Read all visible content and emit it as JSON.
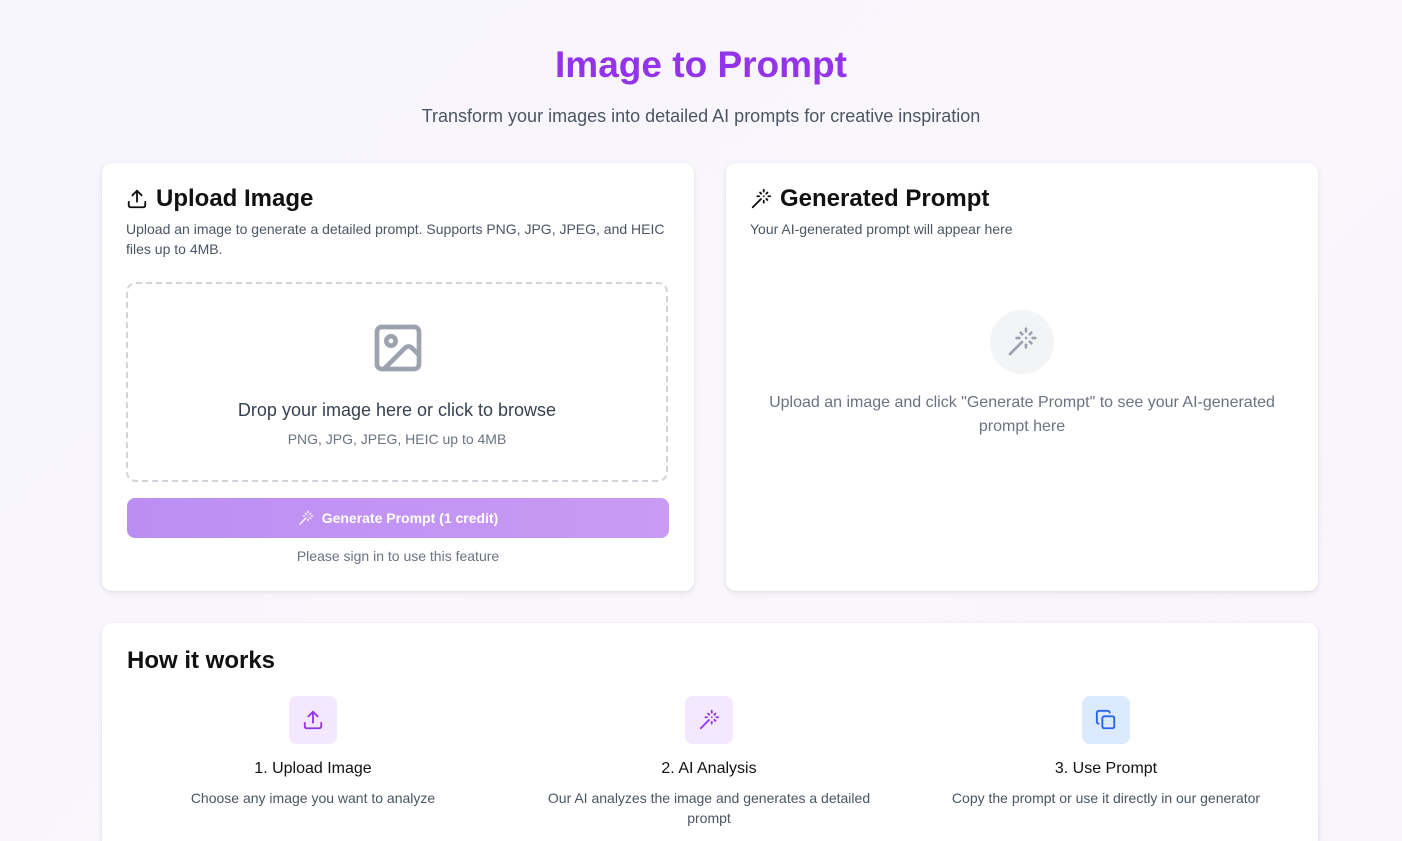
{
  "hero": {
    "title": "Image to Prompt",
    "subtitle": "Transform your images into detailed AI prompts for creative inspiration"
  },
  "upload_card": {
    "icon": "upload-icon",
    "title": "Upload Image",
    "description": "Upload an image to generate a detailed prompt. Supports PNG, JPG, JPEG, and HEIC files up to 4MB.",
    "dropzone": {
      "icon": "image-icon",
      "main_text": "Drop your image here or click to browse",
      "sub_text": "PNG, JPG, JPEG, HEIC up to 4MB"
    },
    "generate_button": {
      "icon": "magic-wand-icon",
      "label": "Generate Prompt (1 credit)"
    },
    "signin_note": "Please sign in to use this feature"
  },
  "prompt_card": {
    "icon": "magic-wand-icon",
    "title": "Generated Prompt",
    "description": "Your AI-generated prompt will appear here",
    "empty_icon": "magic-wand-icon",
    "empty_text": "Upload an image and click \"Generate Prompt\" to see your AI-generated prompt here"
  },
  "how_it_works": {
    "title": "How it works",
    "steps": [
      {
        "icon": "upload-icon",
        "title": "1. Upload Image",
        "description": "Choose any image you want to analyze",
        "icon_bg": "#f3e8ff",
        "icon_color": "#9333ea"
      },
      {
        "icon": "magic-wand-icon",
        "title": "2. AI Analysis",
        "description": "Our AI analyzes the image and generates a detailed prompt",
        "icon_bg": "#f3e8ff",
        "icon_color": "#9333ea"
      },
      {
        "icon": "copy-icon",
        "title": "3. Use Prompt",
        "description": "Copy the prompt or use it directly in our generator",
        "icon_bg": "#dbeafe",
        "icon_color": "#2563eb"
      }
    ]
  },
  "colors": {
    "accent": "#9333ea",
    "button_gradient_start": "#bb8ef4",
    "button_gradient_end": "#c99bf4",
    "text_muted": "#6b7280"
  }
}
